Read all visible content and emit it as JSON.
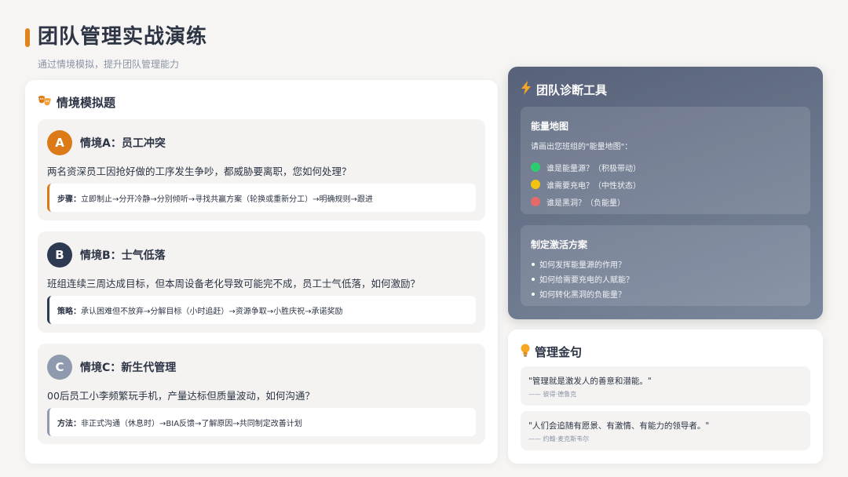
{
  "page": {
    "title": "团队管理实战演练",
    "subtitle": "通过情境模拟，提升团队管理能力",
    "accent_color": "#e0851b"
  },
  "scenarios_section": {
    "icon": "theater-masks-icon",
    "title": "情境模拟题",
    "items": [
      {
        "badge": "A",
        "badge_color": "#dc7a17",
        "title": "情境A：员工冲突",
        "description": "两名资深员工因抢好做的工序发生争吵，都威胁要离职，您如何处理？",
        "note_label": "步骤：",
        "note_text": "立即制止→分开冷静→分别倾听→寻找共赢方案（轮换或重新分工）→明确规则→跟进"
      },
      {
        "badge": "B",
        "badge_color": "#2e3a51",
        "title": "情境B：士气低落",
        "description": "班组连续三周达成目标，但本周设备老化导致可能完不成，员工士气低落，如何激励？",
        "note_label": "策略：",
        "note_text": "承认困难但不放弃→分解目标（小时追赶）→资源争取→小胜庆祝→承诺奖励"
      },
      {
        "badge": "C",
        "badge_color": "#909aae",
        "title": "情境C：新生代管理",
        "description": "00后员工小李频繁玩手机，产量达标但质量波动，如何沟通？",
        "note_label": "方法：",
        "note_text": "非正式沟通（休息时）→BIA反馈→了解原因→共同制定改善计划"
      }
    ]
  },
  "diagnosis": {
    "icon": "lightning-icon",
    "title": "团队诊断工具",
    "energy_map": {
      "title": "能量地图",
      "prompt": "请画出您班组的\"能量地图\"：",
      "items": [
        {
          "label": "谁是能量源？（积极带动）",
          "color": "#2ecc71"
        },
        {
          "label": "谁需要充电？（中性状态）",
          "color": "#f1c40f"
        },
        {
          "label": "谁是黑洞？（负能量）",
          "color": "#e76a6a"
        }
      ]
    },
    "activation_plan": {
      "title": "制定激活方案",
      "items": [
        "如何发挥能量源的作用？",
        "如何给需要充电的人赋能？",
        "如何转化黑洞的负能量？"
      ]
    }
  },
  "quotes_section": {
    "icon": "lightbulb-icon",
    "title": "管理金句",
    "items": [
      {
        "text": "\"管理就是激发人的善意和潜能。\"",
        "author": "—— 彼得·德鲁克"
      },
      {
        "text": "\"人们会追随有愿景、有激情、有能力的领导者。\"",
        "author": "—— 约翰·麦克斯韦尔"
      }
    ]
  }
}
